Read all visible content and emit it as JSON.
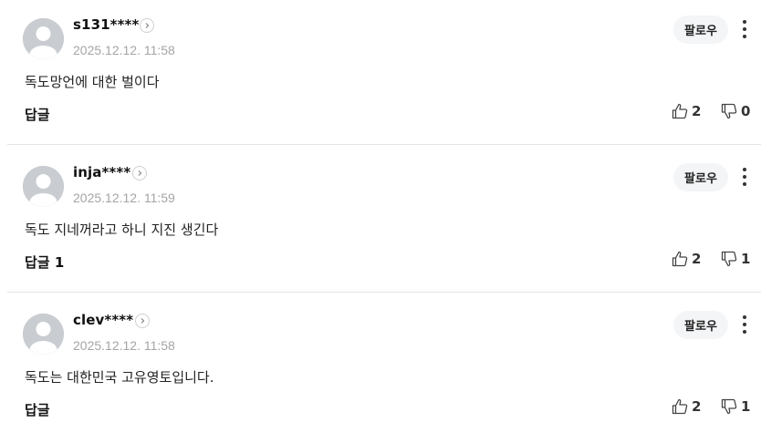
{
  "comments": [
    {
      "username": "s131****",
      "date": "2025.12.12. 11:58",
      "text": "독도망언에 대한 벌이다",
      "reply_label": "답글",
      "follow_label": "팔로우",
      "likes": "2",
      "dislikes": "0"
    },
    {
      "username": "inja****",
      "date": "2025.12.12. 11:59",
      "text": "독도 지네꺼라고 하니 지진 생긴다",
      "reply_label": "답글 1",
      "follow_label": "팔로우",
      "likes": "2",
      "dislikes": "1"
    },
    {
      "username": "clev****",
      "date": "2025.12.12. 11:58",
      "text": "독도는 대한민국 고유영토입니다.",
      "reply_label": "답글",
      "follow_label": "팔로우",
      "likes": "2",
      "dislikes": "1"
    }
  ],
  "icons": {
    "avatar": "default-avatar-icon",
    "profile_arrow": "chevron-right-icon",
    "more": "more-vertical-icon",
    "like": "thumbs-up-icon",
    "dislike": "thumbs-down-icon"
  }
}
